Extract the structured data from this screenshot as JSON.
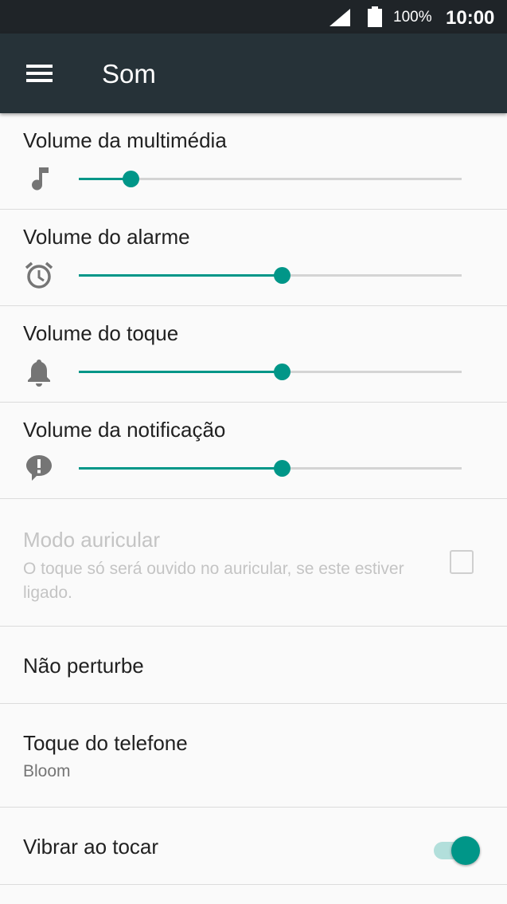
{
  "status_bar": {
    "battery": "100%",
    "time": "10:00"
  },
  "app_bar": {
    "title": "Som"
  },
  "volumes": [
    {
      "label": "Volume da multimédia",
      "icon": "music-note-icon",
      "level": 0.135
    },
    {
      "label": "Volume do alarme",
      "icon": "alarm-clock-icon",
      "level": 0.53
    },
    {
      "label": "Volume do toque",
      "icon": "bell-icon",
      "level": 0.53
    },
    {
      "label": "Volume da notificação",
      "icon": "notification-icon",
      "level": 0.53
    }
  ],
  "earpiece_mode": {
    "label": "Modo auricular",
    "description": "O toque só será ouvido no auricular, se este estiver ligado.",
    "checked": false,
    "enabled": false
  },
  "do_not_disturb": {
    "label": "Não perturbe"
  },
  "ringtone": {
    "label": "Toque do telefone",
    "value": "Bloom"
  },
  "vibrate": {
    "label": "Vibrar ao tocar",
    "on": true
  },
  "colors": {
    "accent": "#009688",
    "app_bar": "#263238",
    "status_bar": "#1f2428"
  }
}
